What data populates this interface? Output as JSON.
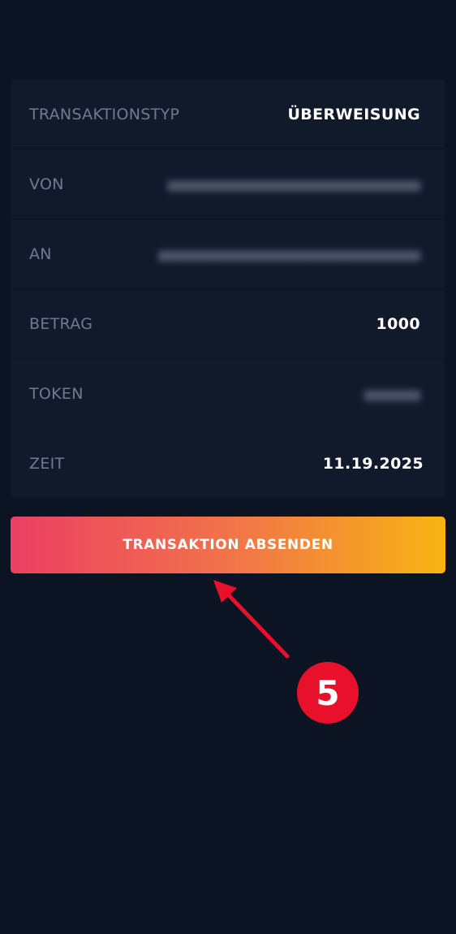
{
  "details": {
    "rows": [
      {
        "label": "TRANSAKTIONSTYP",
        "value": "ÜBERWEISUNG"
      },
      {
        "label": "VON",
        "value": ""
      },
      {
        "label": "AN",
        "value": ""
      },
      {
        "label": "BETRAG",
        "value": "1000"
      },
      {
        "label": "TOKEN",
        "value": ""
      },
      {
        "label": "ZEIT",
        "value": "11.19.2025"
      }
    ]
  },
  "action": {
    "submit_label": "TRANSAKTION ABSENDEN"
  },
  "annotation": {
    "step_number": "5",
    "color": "#e8102a"
  },
  "colors": {
    "background": "#0c1424",
    "card": "#111a2b",
    "button_gradient_start": "#ec3f63",
    "button_gradient_end": "#f8b412"
  }
}
